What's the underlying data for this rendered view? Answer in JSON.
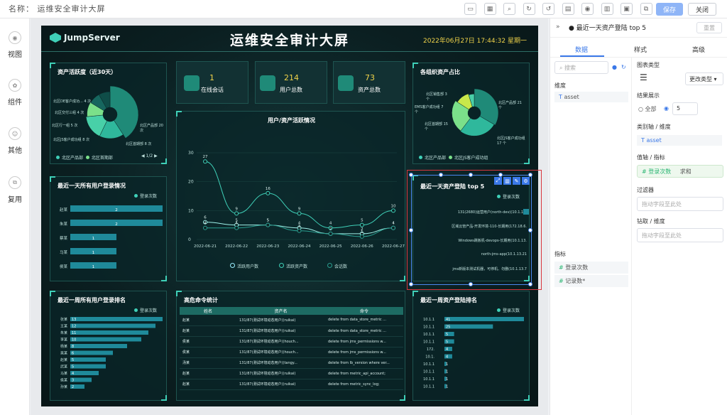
{
  "topbar": {
    "title": "名称： 运维安全审计大屏",
    "save": "保存",
    "close": "关闭",
    "icons": [
      "phone-icon",
      "layout-icon",
      "search-icon",
      "refresh-icon",
      "undo-icon",
      "file-icon",
      "eye-icon",
      "grid-icon",
      "qr-icon",
      "copy-icon"
    ]
  },
  "left_sidebar": [
    {
      "label": "视图",
      "icon": "view-icon"
    },
    {
      "label": "组件",
      "icon": "component-icon"
    },
    {
      "label": "其他",
      "icon": "other-icon"
    },
    {
      "label": "复用",
      "icon": "reuse-icon"
    }
  ],
  "screen": {
    "logo": "JumpServer",
    "title": "运维安全审计大屏",
    "datetime": "2022年06月27日 17:44:32 星期一",
    "stats": [
      {
        "value": "1",
        "label": "在线会话"
      },
      {
        "value": "214",
        "label": "用户总数"
      },
      {
        "value": "73",
        "label": "资产总数"
      }
    ],
    "asset_activity": {
      "title": "资产活跃度（近30天）",
      "labels": [
        "北区DE客户成功... 4 次",
        "北区交付三组 4 次",
        "北区行一组 5 次",
        "北区JS客户成功组 8 次",
        "北区产品部 20 次",
        "北区首期部 8 次"
      ],
      "legend": [
        "北区产品部",
        "北区首期部"
      ],
      "pager": "1/2"
    },
    "org_assets": {
      "title": "各组织资产占比",
      "labels": [
        "北区销售部 3 个",
        "EMS客户成功组 7 个",
        "北区首期部 15 个",
        "北区产品部 21 个",
        "北区JS客户成功组 17 个"
      ],
      "legend": [
        "北区产品部",
        "北区JS客户成功组"
      ]
    },
    "activity_chart": {
      "title": "用户/资产活跃情况",
      "yticks": [
        "0",
        "10",
        "20",
        "30"
      ],
      "legend": [
        "活跃用户数",
        "活跃资产数",
        "会话数"
      ]
    },
    "login_day": {
      "title": "最近一天所有用户登录情况",
      "legend": "登录次数",
      "rows": [
        {
          "name": "赵某",
          "value": "2"
        },
        {
          "name": "朱某",
          "value": "2"
        },
        {
          "name": "蔡某",
          "value": "1"
        },
        {
          "name": "马某",
          "value": "1"
        },
        {
          "name": "侯某",
          "value": "1"
        }
      ]
    },
    "top5": {
      "title": "最近一天资产登陆 top 5",
      "legend": "登录次数",
      "rows": [
        "131(2680)运营用户(north-dev)(10.1.10.",
        "区域云管产品-开发环境-110-长期用(172.18.6.",
        "Windows跳板机-devops-长期用(10.1.13.",
        "north-jms-app(10.1.13.21",
        "jms新版本测试机器，可停机、勿删(10.1.13.7"
      ]
    },
    "login_week": {
      "title": "最近一周所有用户登录排名",
      "legend": "登录次数",
      "rows": [
        {
          "name": "张某",
          "value": "13"
        },
        {
          "name": "王某",
          "value": "12"
        },
        {
          "name": "朱某",
          "value": "11"
        },
        {
          "name": "李某",
          "value": "10"
        },
        {
          "name": "杨某",
          "value": "8"
        },
        {
          "name": "吴某",
          "value": "6"
        },
        {
          "name": "赵某",
          "value": "5"
        },
        {
          "name": "武某",
          "value": "5"
        },
        {
          "name": "马某",
          "value": "4"
        },
        {
          "name": "侯某",
          "value": "3"
        },
        {
          "name": "孙某",
          "value": "2"
        }
      ]
    },
    "commands": {
      "title": "高危命令统计",
      "headers": [
        "姓名",
        "资产名",
        "命令"
      ],
      "rows": [
        [
          "赵某",
          "131/87(测试环境动态用户)(ruikai)",
          "delete from data_store_metric ..."
        ],
        [
          "赵某",
          "131/87(测试环境动态用户)(ruikai)",
          "delete from data_store_metric ..."
        ],
        [
          "侯某",
          "131/87(测试环境动态用户)(houch...",
          "delete from jms_permissions w..."
        ],
        [
          "侯某",
          "131/87(测试环境动态用户)(houch...",
          "delete from jms_permissions w..."
        ],
        [
          "汤某",
          "131/87(测试环境动态用户)(tangy...",
          "delete from lb_version where ver..."
        ],
        [
          "赵某",
          "131/87(测试环境动态用户)(ruikai)",
          "delete from metric_api_account;"
        ],
        [
          "赵某",
          "131/87(测试环境动态用户)(ruikai)",
          "delete from metric_sync_log;"
        ]
      ]
    },
    "asset_week": {
      "title": "最近一周资产登陆排名",
      "legend": "登录次数",
      "rows": [
        {
          "name": "10.1.1",
          "value": "41"
        },
        {
          "name": "10.1.1",
          "value": "25"
        },
        {
          "name": "10.1.1",
          "value": "5"
        },
        {
          "name": "10.1.1",
          "value": "5"
        },
        {
          "name": "172.",
          "value": "4"
        },
        {
          "name": "10.1.",
          "value": "4"
        },
        {
          "name": "10.1.1",
          "value": "1"
        },
        {
          "name": "10.1.1",
          "value": "1"
        },
        {
          "name": "10.1.1",
          "value": "1"
        },
        {
          "name": "10.1.1",
          "value": "1"
        }
      ]
    }
  },
  "chart_data": [
    {
      "type": "line",
      "title": "用户/资产活跃情况",
      "x": [
        "2022-06-21",
        "2022-06-22",
        "2022-06-23",
        "2022-06-24",
        "2022-06-25",
        "2022-06-26",
        "2022-06-27"
      ],
      "ylim": [
        0,
        30
      ],
      "series": [
        {
          "name": "活跃用户数",
          "values": [
            6,
            5,
            5,
            4,
            2,
            2,
            4
          ]
        },
        {
          "name": "活跃资产数",
          "values": [
            27,
            9,
            16,
            9,
            4,
            5,
            10
          ]
        },
        {
          "name": "会话数",
          "values": [
            4,
            4,
            5,
            3,
            2,
            1,
            4
          ]
        }
      ]
    },
    {
      "type": "bar",
      "title": "最近一天所有用户登录情况",
      "categories": [
        "赵某",
        "朱某",
        "蔡某",
        "马某",
        "侯某"
      ],
      "values": [
        2,
        2,
        1,
        1,
        1
      ],
      "xlim": [
        0,
        2
      ]
    },
    {
      "type": "bar",
      "title": "最近一周所有用户登录排名",
      "categories": [
        "张某",
        "王某",
        "朱某",
        "李某",
        "杨某",
        "吴某",
        "赵某",
        "武某",
        "马某",
        "侯某",
        "孙某"
      ],
      "values": [
        13,
        12,
        11,
        10,
        8,
        6,
        5,
        5,
        4,
        3,
        2
      ],
      "xlim": [
        0,
        13
      ]
    },
    {
      "type": "bar",
      "title": "最近一周资产登陆排名",
      "values": [
        41,
        25,
        5,
        5,
        4,
        4,
        1,
        1,
        1,
        1
      ],
      "xlim": [
        0,
        41
      ]
    },
    {
      "type": "pie",
      "title": "资产活跃度（近30天）",
      "values": [
        20,
        8,
        8,
        5,
        4,
        4
      ]
    },
    {
      "type": "pie",
      "title": "各组织资产占比",
      "values": [
        21,
        17,
        15,
        7,
        3
      ]
    }
  ],
  "right_panel": {
    "title": "最近一天资产登陆 top 5",
    "reset": "重置",
    "tabs": [
      "数据",
      "样式",
      "高级"
    ],
    "search_placeholder": "搜索",
    "dim_label": "维度",
    "dim_field": "asset",
    "metric_label": "指标",
    "metric_fields": [
      "登录次数",
      "记录数*"
    ],
    "chart_type_label": "图表类型",
    "change_type": "更改类型",
    "result_label": "结果展示",
    "opt_all": "全部",
    "opt_num": "5",
    "axis_label": "类别轴 / 维度",
    "axis_field": "asset",
    "value_label": "值轴 / 指标",
    "value_field": "登录次数",
    "agg": "求和",
    "filter_label": "过滤器",
    "filter_ph": "拖动字段至此处",
    "drill_label": "钻取 / 维度",
    "drill_ph": "拖动字段至此处"
  }
}
